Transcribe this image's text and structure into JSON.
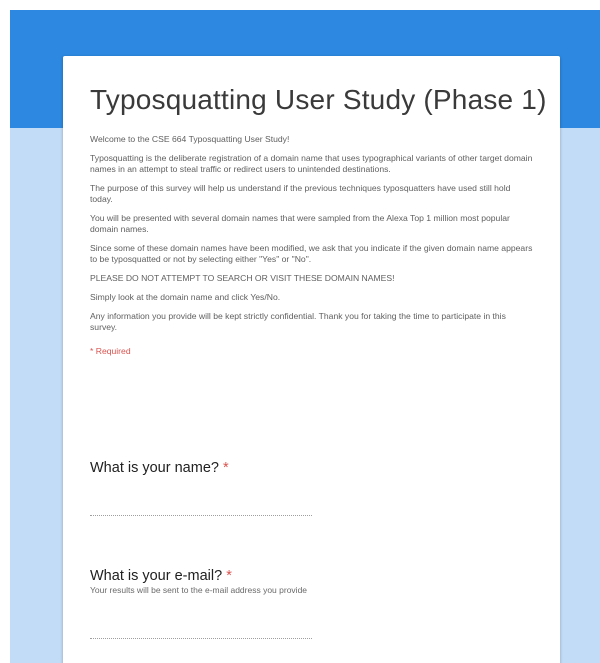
{
  "form": {
    "title": "Typosquatting User Study (Phase 1)",
    "description": [
      "Welcome to the CSE 664 Typosquatting User Study!",
      "Typosquatting is the deliberate registration of a domain name that uses typographical variants of other target domain names in an attempt to steal traffic or redirect users to unintended destinations.",
      "The purpose of this survey will help us understand if the previous techniques typosquatters have used still hold today.",
      "You will be presented with several domain names that were sampled from the Alexa Top 1 million most popular domain names.",
      "Since some of these domain names have been modified, we ask that you indicate if the given domain name appears to be typosquatted or not by selecting either \"Yes\" or \"No\".",
      "PLEASE DO NOT ATTEMPT TO SEARCH OR VISIT THESE DOMAIN NAMES!",
      "Simply look at the domain name and click Yes/No.",
      "Any information you provide will be kept strictly confidential. Thank you for taking the time to participate in this survey."
    ],
    "required_note": "* Required"
  },
  "questions": {
    "name": {
      "title": "What is your name?",
      "required_marker": "*",
      "value": ""
    },
    "email": {
      "title": "What is your e-mail?",
      "required_marker": "*",
      "help": "Your results will be sent to the e-mail address you provide",
      "value": ""
    }
  },
  "colors": {
    "header": "#2c88e0",
    "background": "#c2dcf7",
    "required": "#d9534f"
  }
}
